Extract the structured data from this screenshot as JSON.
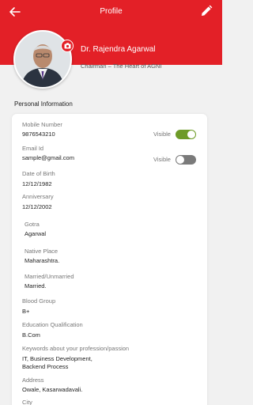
{
  "header": {
    "title": "Profile",
    "back_icon": "arrow-left-icon",
    "edit_icon": "pencil-icon",
    "color": "#e32027"
  },
  "profile": {
    "name": "Dr. Rajendra Agarwal",
    "role": "Chairman – The Heart of AGNI",
    "camera_icon": "camera-icon"
  },
  "section": {
    "title": "Personal Information"
  },
  "fields": {
    "mobile": {
      "label": "Mobile Number",
      "value": "9876543210",
      "visibility_label": "Visible",
      "visible": true
    },
    "email": {
      "label": "Email Id",
      "value": "sample@gmail.com",
      "visibility_label": "Visible",
      "visible": false
    },
    "dob": {
      "label": "Date of Birth",
      "value": "12/12/1982"
    },
    "anniversary": {
      "label": "Anniversary",
      "value": "12/12/2002"
    },
    "gotra": {
      "label": "Gotra",
      "value": "Agarwal"
    },
    "native": {
      "label": "Native Place",
      "value": "Maharashtra."
    },
    "marital": {
      "label": "Married/Unmarried",
      "value": "Married."
    },
    "blood": {
      "label": "Blood Group",
      "value": "B+"
    },
    "education": {
      "label": "Education Qualification",
      "value": "B.Com"
    },
    "keywords": {
      "label": "Keywords about your profession/passion",
      "value_line1": "IT, Business Development,",
      "value_line2": "Backend Process"
    },
    "address": {
      "label": "Address",
      "value": "Owale, Kasarwadavali."
    },
    "city": {
      "label": "City"
    }
  }
}
